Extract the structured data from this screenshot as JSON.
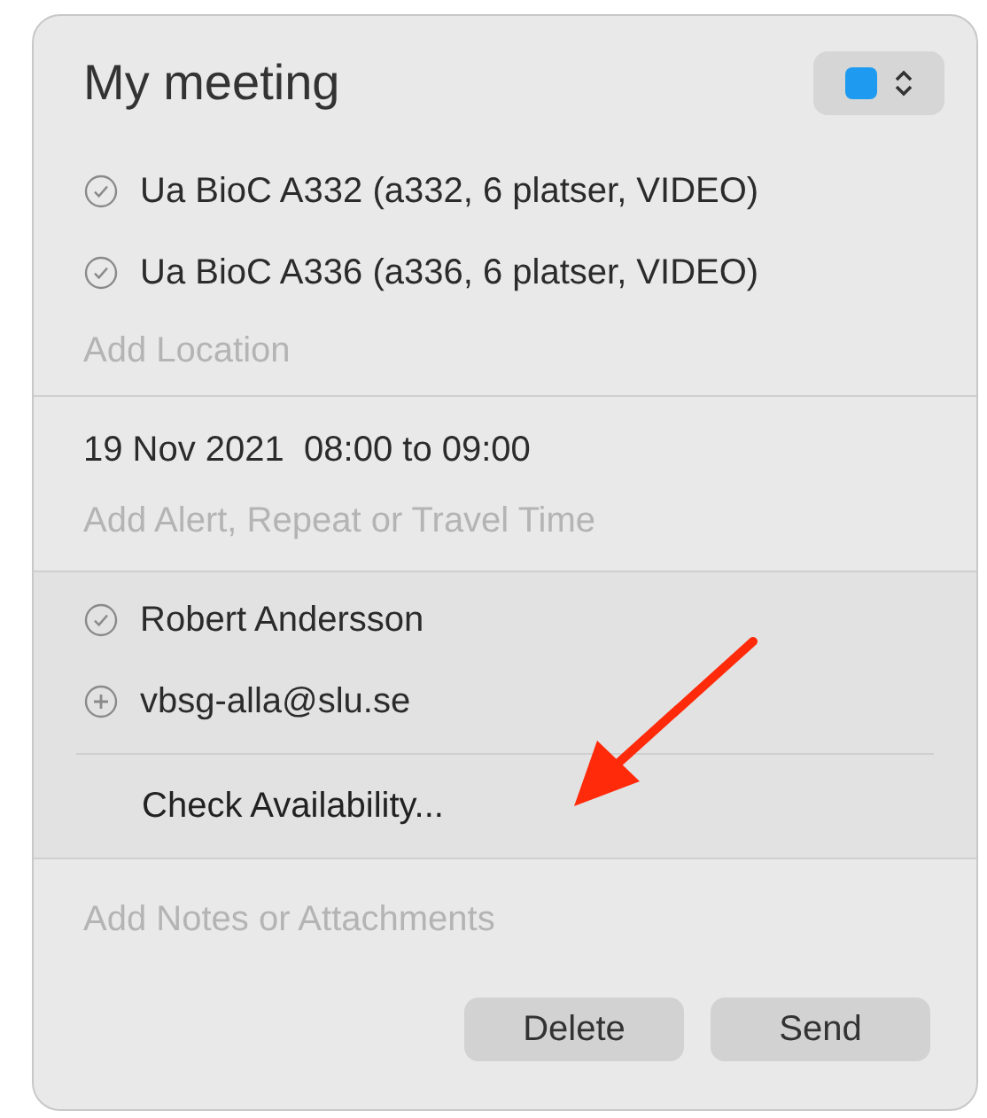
{
  "title": "My meeting",
  "calendar": {
    "color": "#1e9bf0"
  },
  "locations": [
    {
      "name": "Ua BioC A332 (a332, 6 platser, VIDEO)",
      "kind": "accepted"
    },
    {
      "name": "Ua BioC A336 (a336, 6 platser, VIDEO)",
      "kind": "accepted"
    }
  ],
  "location_placeholder": "Add Location",
  "datetime": "19 Nov 2021  08:00 to 09:00",
  "alert_placeholder": "Add Alert, Repeat or Travel Time",
  "attendees": [
    {
      "name": "Robert Andersson",
      "kind": "accepted"
    },
    {
      "name": "vbsg-alla@slu.se",
      "kind": "pending"
    }
  ],
  "check_availability": "Check Availability...",
  "notes_placeholder": "Add Notes or Attachments",
  "buttons": [
    "Delete",
    "Send"
  ]
}
